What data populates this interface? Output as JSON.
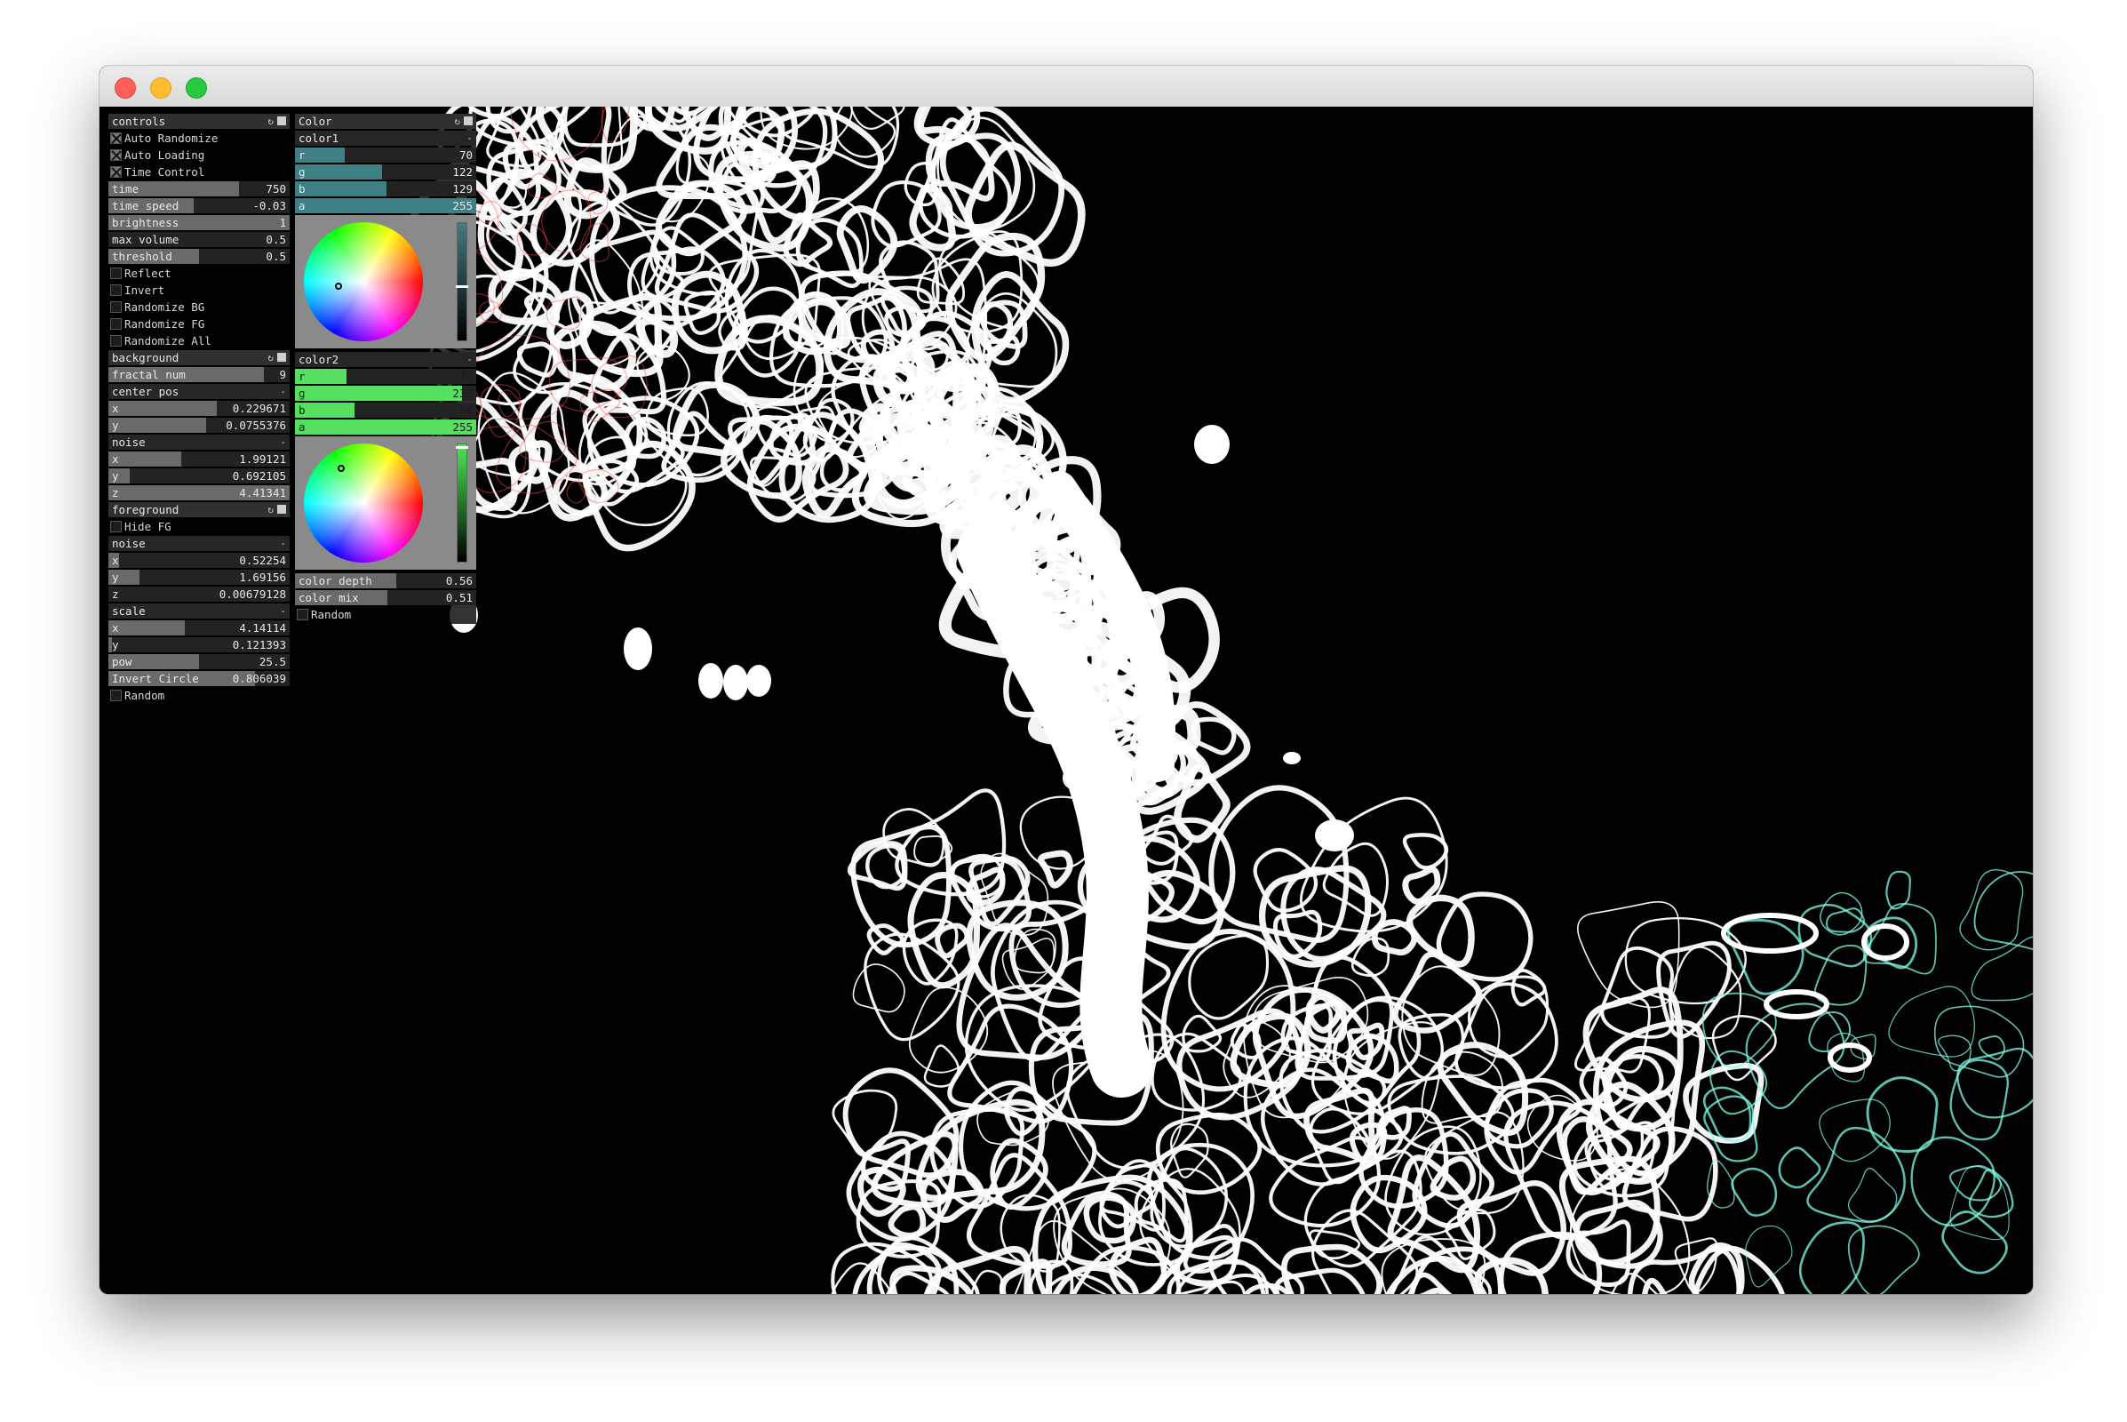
{
  "window": {
    "buttons": {
      "close": "close",
      "minimize": "minimize",
      "maximize": "maximize"
    }
  },
  "controls_panel": {
    "title": "controls",
    "toggles": [
      {
        "label": "Auto Randomize",
        "checked": true
      },
      {
        "label": "Auto Loading",
        "checked": true
      },
      {
        "label": "Time Control",
        "checked": true
      }
    ],
    "sliders": [
      {
        "label": "time",
        "value": "750",
        "fill": 0.72
      },
      {
        "label": "time speed",
        "value": "-0.03",
        "fill": 0.47
      },
      {
        "label": "brightness",
        "value": "1",
        "fill": 1.0
      },
      {
        "label": "max volume",
        "value": "0.5",
        "fill": 0.0
      },
      {
        "label": "threshold",
        "value": "0.5",
        "fill": 0.5
      }
    ],
    "toggles2": [
      {
        "label": "Reflect",
        "checked": false
      },
      {
        "label": "Invert",
        "checked": false
      },
      {
        "label": "Randomize BG",
        "checked": false
      },
      {
        "label": "Randomize FG",
        "checked": false
      },
      {
        "label": "Randomize All",
        "checked": false
      }
    ],
    "background": {
      "title": "background",
      "fractal": {
        "label": "fractal num",
        "value": "9",
        "fill": 0.86
      },
      "center_pos": {
        "title": "center pos",
        "collapse": "-",
        "x": {
          "label": "x",
          "value": "0.229671",
          "fill": 0.6
        },
        "y": {
          "label": "y",
          "value": "0.0755376",
          "fill": 0.54
        }
      },
      "noise": {
        "title": "noise",
        "collapse": "-",
        "x": {
          "label": "x",
          "value": "1.99121",
          "fill": 0.4
        },
        "y": {
          "label": "y",
          "value": "0.692105",
          "fill": 0.12
        },
        "z": {
          "label": "z",
          "value": "4.41341",
          "fill": 1.0
        }
      }
    },
    "foreground": {
      "title": "foreground",
      "hide_fg": {
        "label": "Hide FG",
        "checked": false
      },
      "noise": {
        "title": "noise",
        "collapse": "-",
        "x": {
          "label": "x",
          "value": "0.52254",
          "fill": 0.06
        },
        "y": {
          "label": "y",
          "value": "1.69156",
          "fill": 0.17
        },
        "z": {
          "label": "z",
          "value": "0.00679128",
          "fill": 0.0
        }
      },
      "scale": {
        "title": "scale",
        "collapse": "-",
        "x": {
          "label": "x",
          "value": "4.14114",
          "fill": 0.42
        },
        "y": {
          "label": "y",
          "value": "0.121393",
          "fill": 0.02
        }
      },
      "pow": {
        "label": "pow",
        "value": "25.5",
        "fill": 0.5
      },
      "invert_circle": {
        "label": "Invert Circle",
        "value": "0.806039",
        "fill": 0.81
      },
      "random": {
        "label": "Random",
        "checked": false
      }
    }
  },
  "color_panel": {
    "title": "Color",
    "color1": {
      "title": "color1",
      "collapse": "-",
      "r": {
        "label": "r",
        "value": "70",
        "fill": 0.275
      },
      "g": {
        "label": "g",
        "value": "122",
        "fill": 0.478
      },
      "b": {
        "label": "b",
        "value": "129",
        "fill": 0.506
      },
      "a": {
        "label": "a",
        "value": "255",
        "fill": 1.0
      },
      "swatch": "#467a81"
    },
    "color2": {
      "title": "color2",
      "collapse": "-",
      "r": {
        "label": "r",
        "value": "72",
        "fill": 0.282
      },
      "g": {
        "label": "g",
        "value": "235",
        "fill": 0.92
      },
      "b": {
        "label": "b",
        "value": "84",
        "fill": 0.33
      },
      "a": {
        "label": "a",
        "value": "255",
        "fill": 1.0
      },
      "swatch": "#48eb54"
    },
    "color_depth": {
      "label": "color depth",
      "value": "0.56",
      "fill": 0.56
    },
    "color_mix": {
      "label": "color mix",
      "value": "0.51",
      "fill": 0.51
    },
    "random": {
      "label": "Random",
      "checked": false
    }
  },
  "colors": {
    "canvas_bg": "#000000",
    "stroke": "#ffffff",
    "accent_teal": "#3f7f86",
    "accent_green": "#55e060",
    "cyan_glow": "#7fffe8",
    "red_glow": "#ff4d4d"
  }
}
